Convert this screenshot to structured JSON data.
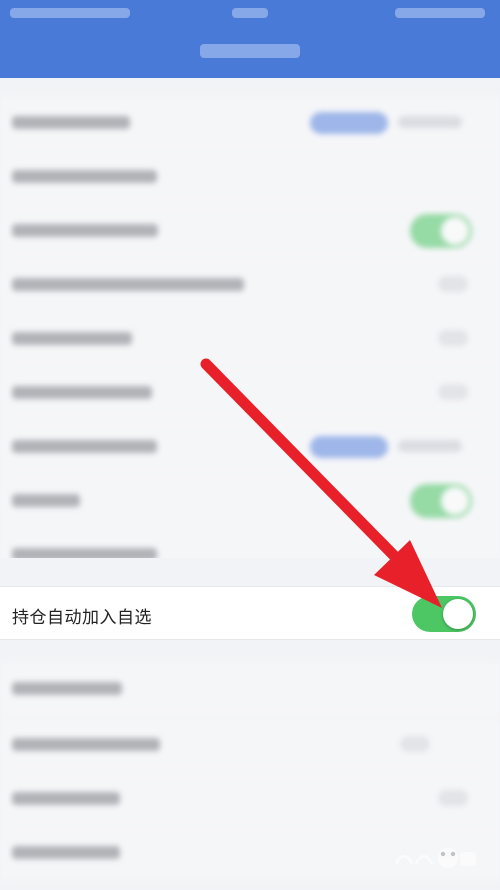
{
  "setting_row": {
    "label": "持仓自动加入自选",
    "toggle_state": "on"
  },
  "colors": {
    "header": "#4a7ad8",
    "toggle_on": "#4cc764",
    "arrow": "#e8202a",
    "background": "#f2f3f6"
  },
  "annotation": {
    "icon": "red-arrow-pointer"
  }
}
